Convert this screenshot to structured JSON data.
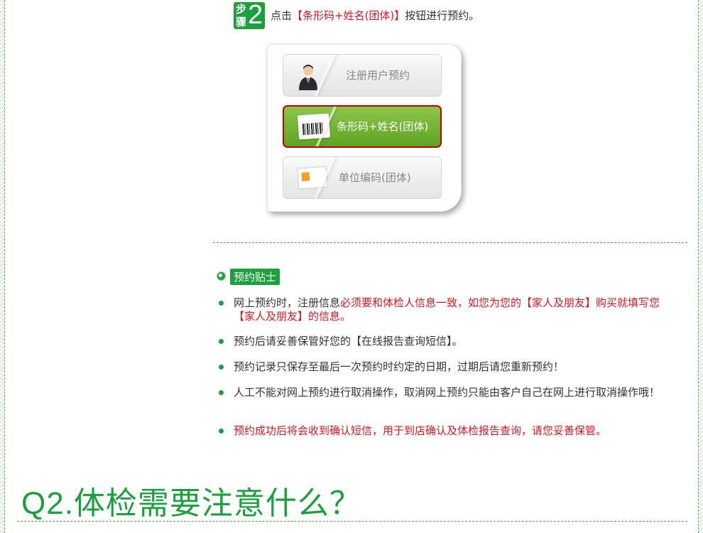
{
  "step": {
    "badge_label": "步骤",
    "badge_number": "2",
    "text_prefix": "点击",
    "text_highlight": "【条形码+姓名(团体)】",
    "text_suffix": "按钮进行预约。"
  },
  "panel": {
    "buttons": [
      {
        "label": "注册用户预约",
        "icon": "user-avatar-icon"
      },
      {
        "label": "条形码+姓名(团体)",
        "icon": "barcode-icon"
      },
      {
        "label": "单位编码(团体)",
        "icon": "id-card-icon"
      }
    ]
  },
  "tips": {
    "title": "预约贴士",
    "items": [
      {
        "normal": "网上预约时，注册信息",
        "red": "必须要和体检人信息一致，如您为您的【家人及朋友】购买就填写您【家人及朋友】的信息。"
      },
      {
        "normal": "预约后请妥善保管好您的【在线报告查询短信】。",
        "red": ""
      },
      {
        "normal": "预约记录只保存至最后一次预约时约定的日期，过期后请您重新预约！",
        "red": ""
      },
      {
        "normal": "人工不能对网上预约进行取消操作，取消网上预约只能由客户自己在网上进行取消操作哦！",
        "red": ""
      },
      {
        "normal": "",
        "red": "预约成功后将会收到确认短信，用于到店确认及体检报告查询，请您妥善保管。"
      }
    ]
  },
  "section_title": "Q2.体检需要注意什么？",
  "colors": {
    "accent_green": "#1aa03c",
    "highlight_red": "#e0141e",
    "button_green": "#6db52e"
  }
}
